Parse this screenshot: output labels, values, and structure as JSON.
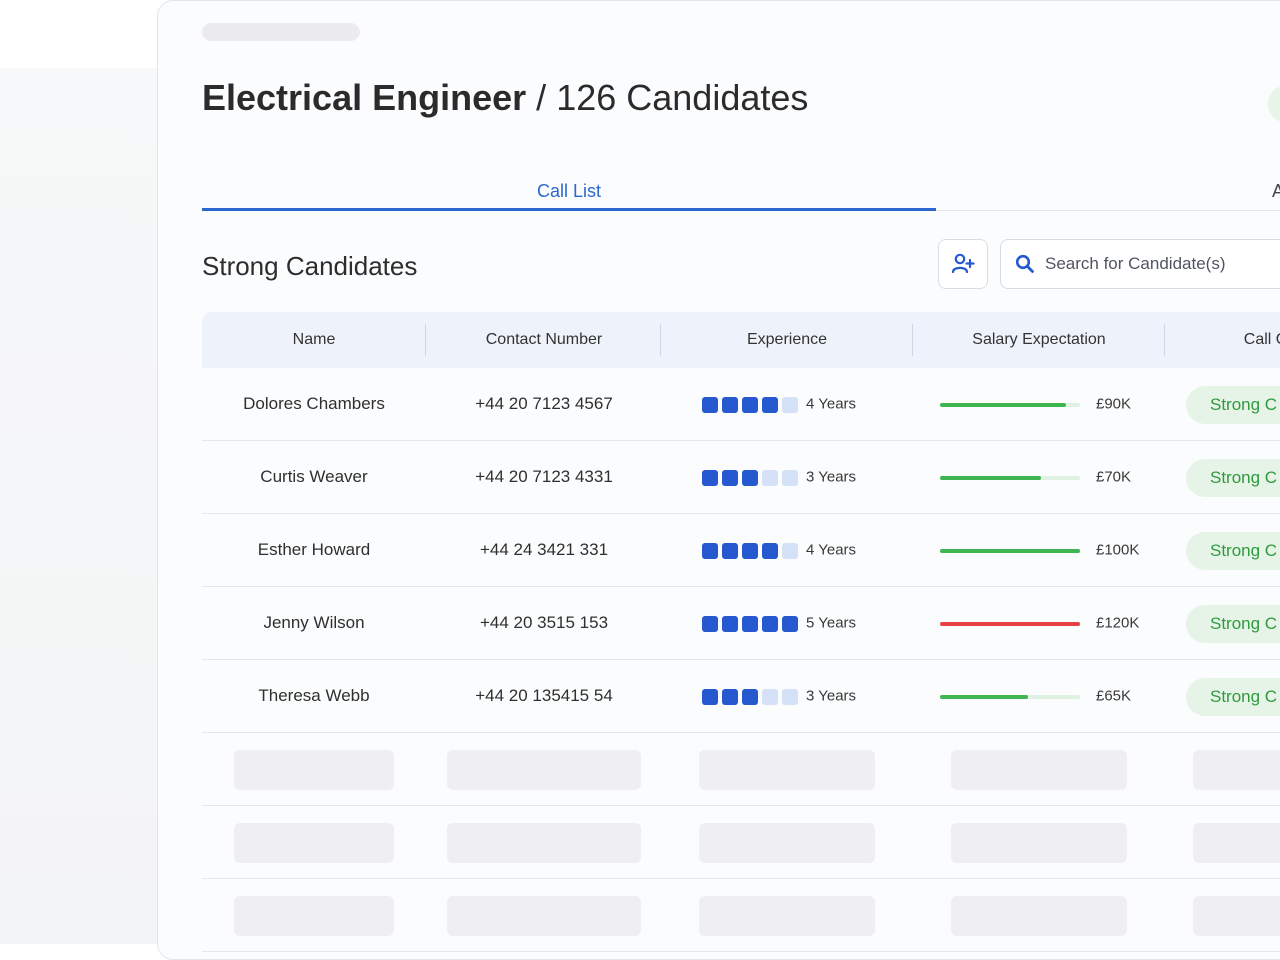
{
  "page": {
    "role": "Electrical Engineer",
    "separator": "/",
    "count_label": "126 Candidates"
  },
  "tabs": {
    "active_label": "Call List",
    "other_label": "A"
  },
  "section": {
    "title": "Strong Candidates",
    "add_icon": "add-user-icon",
    "search_icon": "search-icon",
    "search_placeholder": "Search for Candidate(s)"
  },
  "table": {
    "headers": {
      "name": "Name",
      "contact": "Contact Number",
      "experience": "Experience",
      "salary": "Salary Expectation",
      "call": "Call O"
    },
    "rows": [
      {
        "name": "Dolores Chambers",
        "phone": "+44 20 7123 4567",
        "exp_level": 4,
        "exp_label": "4 Years",
        "salary_fraction": 0.9,
        "salary_color": "#3fb552",
        "salary": "£90K",
        "call": "Strong C"
      },
      {
        "name": "Curtis Weaver",
        "phone": "+44 20 7123 4331",
        "exp_level": 3,
        "exp_label": "3 Years",
        "salary_fraction": 0.72,
        "salary_color": "#3fb552",
        "salary": "£70K",
        "call": "Strong C"
      },
      {
        "name": "Esther Howard",
        "phone": "+44 24 3421 331",
        "exp_level": 4,
        "exp_label": "4 Years",
        "salary_fraction": 1.0,
        "salary_color": "#3fb552",
        "salary": "£100K",
        "call": "Strong C"
      },
      {
        "name": "Jenny Wilson",
        "phone": "+44 20 3515 153",
        "exp_level": 5,
        "exp_label": "5 Years",
        "salary_fraction": 1.0,
        "salary_color": "#e8413f",
        "salary": "£120K",
        "call": "Strong C"
      },
      {
        "name": "Theresa Webb",
        "phone": "+44 20 135415 54",
        "exp_level": 3,
        "exp_label": "3 Years",
        "salary_fraction": 0.63,
        "salary_color": "#3fb552",
        "salary": "£65K",
        "call": "Strong C"
      }
    ]
  },
  "colors": {
    "accent": "#2c67cf",
    "exp_on": "#2659cf",
    "exp_off": "#d5e1f6",
    "badge_bg": "#e6f4e7",
    "badge_text": "#2f9a3e"
  }
}
